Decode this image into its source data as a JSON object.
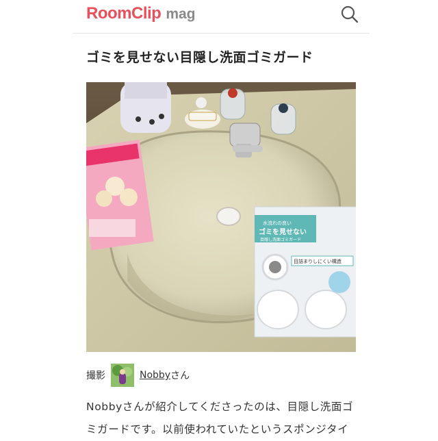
{
  "header": {
    "logo_main": "RoomClip",
    "logo_sub": "mag",
    "search_icon": "search-icon"
  },
  "article": {
    "title": "ゴミを見せない目隠し洗面ゴミガード",
    "photo_package_text": {
      "line1": "水流れの良い",
      "line2": "ゴミを見せない",
      "line3": "目隠し洗面ゴミガード",
      "line4": "目詰まりしにくい構造"
    }
  },
  "credit": {
    "label": "撮影",
    "username": "Nobby",
    "suffix": "さん"
  },
  "body": {
    "text": "Nobbyさんが紹介してくださったのは、目隠し洗面ゴミガードです。以前使われていたというスポンジタイ"
  },
  "colors": {
    "brand": "#e8505b",
    "logo_sub": "#8a8a8a",
    "text": "#333333"
  }
}
